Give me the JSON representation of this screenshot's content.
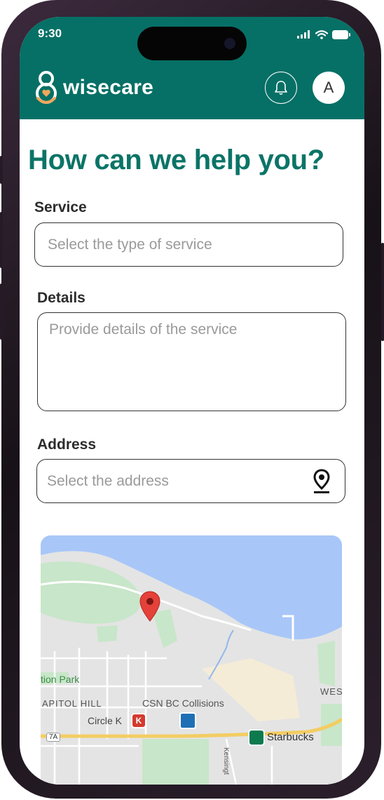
{
  "status_bar": {
    "time": "9:30"
  },
  "header": {
    "brand": "wisecare",
    "avatar_initial": "A",
    "bell_icon": "bell-icon",
    "colors": {
      "header_bg": "#067066",
      "title": "#0b7467"
    }
  },
  "form": {
    "title": "How can we help you?",
    "service": {
      "label": "Service",
      "placeholder": "Select the type of service",
      "value": ""
    },
    "details": {
      "label": "Details",
      "placeholder": "Provide details of the service",
      "value": ""
    },
    "address": {
      "label": "Address",
      "placeholder": "Select the address",
      "value": "",
      "icon": "map-pin-icon"
    }
  },
  "map": {
    "labels": {
      "park": "tion Park",
      "hill": "APITOL HILL",
      "collisions": "CSN BC Collisions",
      "circle_k": "Circle K",
      "starbucks": "Starbucks",
      "wes": "WES",
      "kensington": "Kensingt",
      "route": "7A"
    },
    "marker_icon": "location-marker-icon"
  }
}
